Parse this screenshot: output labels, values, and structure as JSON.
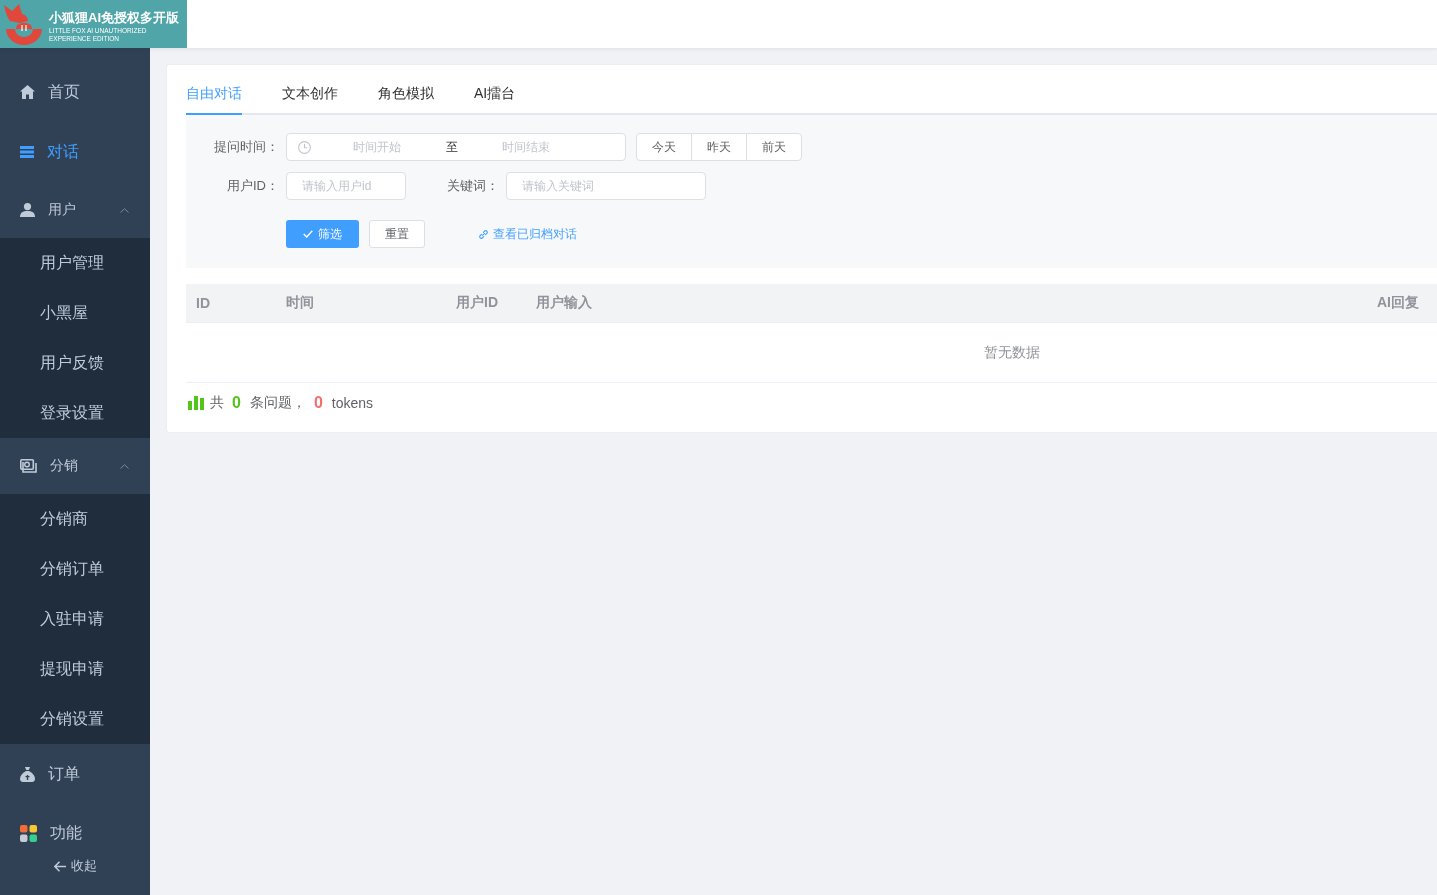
{
  "logo": {
    "title": "小狐狸AI免授权多开版",
    "subtitle": "LITTLE FOX AI UNAUTHORIZED EXPERIENCE EDITION"
  },
  "sidebar": {
    "items": [
      {
        "kind": "item",
        "label": "首页",
        "selected": false
      },
      {
        "kind": "item",
        "label": "对话",
        "selected": true
      },
      {
        "kind": "group",
        "label": "用户",
        "selected": false,
        "expanded": true,
        "children": [
          {
            "label": "用户管理",
            "selected": false
          },
          {
            "label": "小黑屋",
            "selected": false
          },
          {
            "label": "用户反馈",
            "selected": false
          },
          {
            "label": "登录设置",
            "selected": false
          }
        ]
      },
      {
        "kind": "group",
        "label": "分销",
        "selected": false,
        "expanded": true,
        "children": [
          {
            "label": "分销商",
            "selected": false
          },
          {
            "label": "分销订单",
            "selected": false
          },
          {
            "label": "入驻申请",
            "selected": false
          },
          {
            "label": "提现申请",
            "selected": false
          },
          {
            "label": "分销设置",
            "selected": false
          }
        ]
      },
      {
        "kind": "item",
        "label": "订单",
        "selected": false
      },
      {
        "kind": "item",
        "label": "功能",
        "selected": false
      }
    ],
    "collapse": "收起"
  },
  "tabs": [
    {
      "label": "自由对话",
      "selected": true
    },
    {
      "label": "文本创作",
      "selected": false
    },
    {
      "label": "角色模拟",
      "selected": false
    },
    {
      "label": "AI擂台",
      "selected": false
    }
  ],
  "filters": {
    "time": {
      "label": "提问时间：",
      "start": {
        "placeholder": "时间开始"
      },
      "separator": "至",
      "end": {
        "placeholder": "时间结束"
      }
    },
    "quick_dates": [
      "今天",
      "昨天",
      "前天"
    ],
    "user_id": {
      "label": "用户ID：",
      "placeholder": "请输入用户id"
    },
    "keyword": {
      "label": "关键词：",
      "placeholder": "请输入关键词"
    },
    "filter_button": "筛选",
    "reset_button": "重置",
    "archive_link": "查看已归档对话"
  },
  "table": {
    "columns": [
      "ID",
      "时间",
      "用户ID",
      "用户输入",
      "AI回复"
    ],
    "empty_text": "暂无数据"
  },
  "summary": {
    "prefix": "共",
    "question_count": "0",
    "middle": "条问题，",
    "token_count": "0",
    "suffix": "tokens"
  }
}
